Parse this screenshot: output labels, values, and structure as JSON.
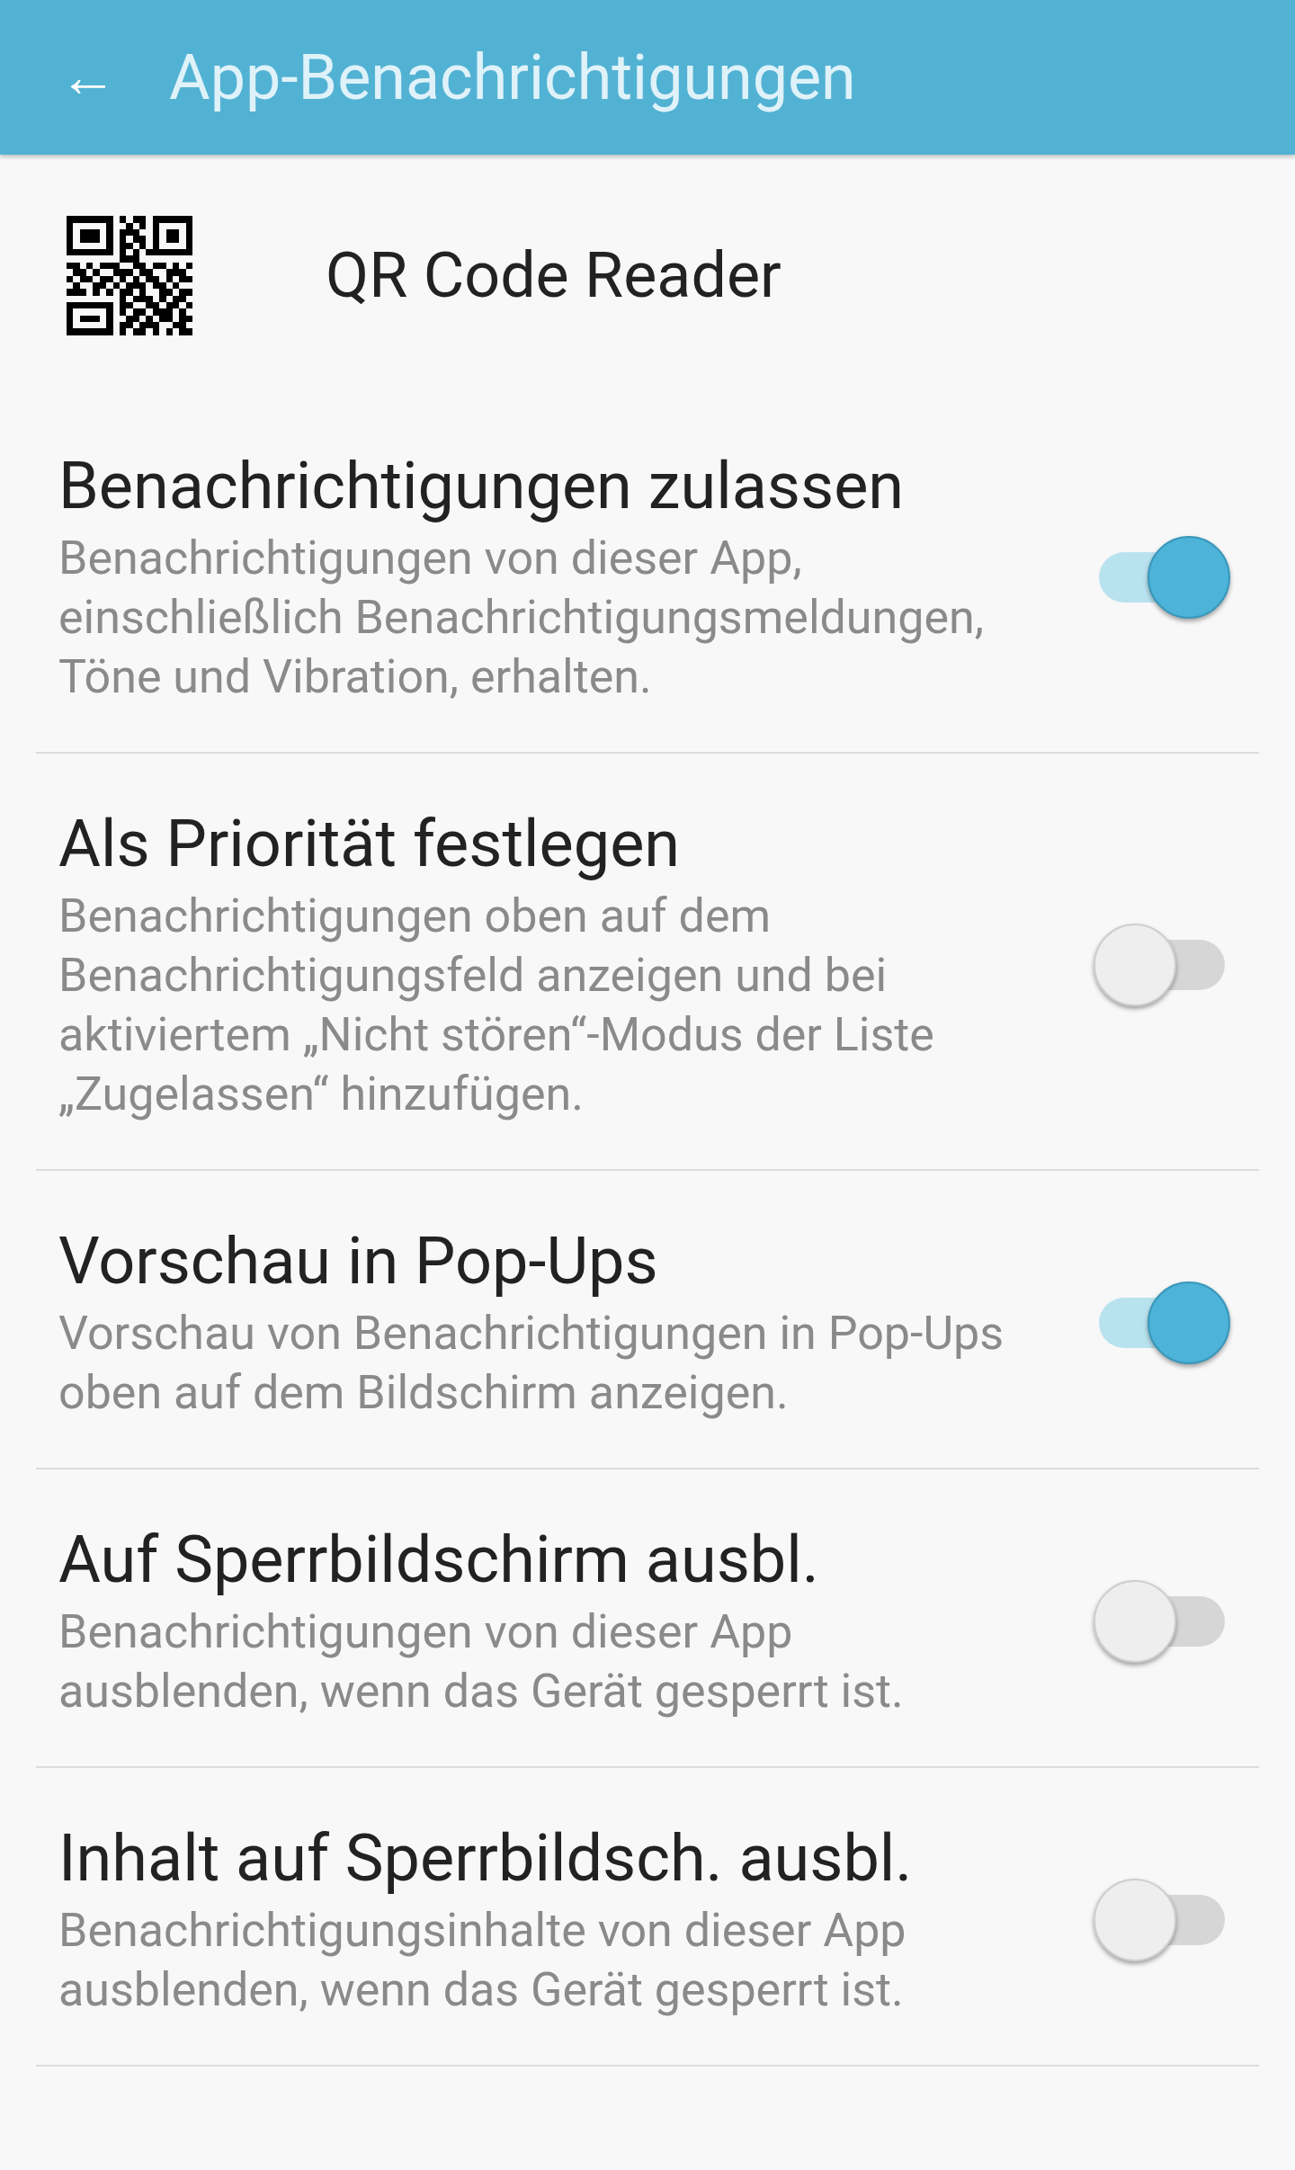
{
  "header": {
    "back": "←",
    "title": "App-Benachrichtigungen"
  },
  "app": {
    "name": "QR Code Reader"
  },
  "settings": [
    {
      "title": "Benachrichtigungen zulassen",
      "description": "Benachrichtigungen von dieser App, einschließlich Benachrichtigungsmeldungen, Töne und Vibration, erhalten.",
      "on": true
    },
    {
      "title": "Als Priorität festlegen",
      "description": "Benachrichtigungen oben auf dem Benachrichtigungsfeld anzeigen und bei aktiviertem „Nicht stören“-Modus der Liste „Zugelassen“ hinzufügen.",
      "on": false
    },
    {
      "title": "Vorschau in Pop-Ups",
      "description": "Vorschau von Benachrichtigungen in Pop-Ups oben auf dem Bildschirm anzeigen.",
      "on": true
    },
    {
      "title": "Auf Sperrbildschirm ausbl.",
      "description": "Benachrichtigungen von dieser App ausblenden, wenn das Gerät gesperrt ist.",
      "on": false
    },
    {
      "title": "Inhalt auf Sperrbildsch. ausbl.",
      "description": "Benachrichtigungsinhalte von dieser App ausblenden, wenn das Gerät gesperrt ist.",
      "on": false
    }
  ]
}
